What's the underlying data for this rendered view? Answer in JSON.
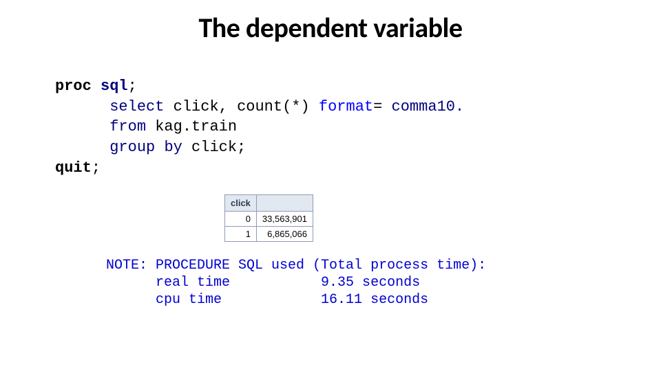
{
  "title": "The dependent variable",
  "code": {
    "proc": "proc",
    "sql": "sql",
    "semicolon1": ";",
    "indent": "      ",
    "select": "select",
    "click": " click, ",
    "count": "count(*) ",
    "format": "format",
    "eq_comma": "= ",
    "comma10": "comma10.",
    "from": "from",
    "kag": " kag.train",
    "group": "group",
    "by": "by",
    "click2": " click;",
    "quit": "quit",
    "semicolon2": ";"
  },
  "table": {
    "header1": "click",
    "header2": "",
    "rows": [
      [
        "0",
        "33,563,901"
      ],
      [
        "1",
        "6,865,066"
      ]
    ]
  },
  "log": {
    "l1a": "NOTE: PROCEDURE SQL used (Total process time):",
    "l2a": "      real time           9.35 seconds",
    "l3a": "      cpu time            16.11 seconds"
  },
  "chart_data": {
    "type": "table",
    "title": "click counts",
    "columns": [
      "click",
      "count"
    ],
    "rows": [
      {
        "click": 0,
        "count": 33563901
      },
      {
        "click": 1,
        "count": 6865066
      }
    ]
  }
}
